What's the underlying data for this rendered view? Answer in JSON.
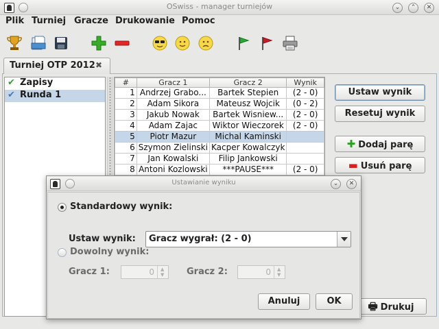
{
  "window": {
    "title": "OSwiss - manager turniejów",
    "minimize": "⌄",
    "maximize": "⌃",
    "close": "✕"
  },
  "menu": [
    "Plik",
    "Turniej",
    "Gracze",
    "Drukowanie",
    "Pomoc"
  ],
  "toolbar": {
    "icons": [
      "trophy-icon",
      "open-icon",
      "save-icon",
      "add-icon",
      "remove-icon",
      "cool-face-icon",
      "smile-face-icon",
      "sad-face-icon",
      "green-flag-icon",
      "red-flag-icon",
      "printer-icon"
    ]
  },
  "tab": {
    "label": "Turniej OTP 2012",
    "close": "✖"
  },
  "rounds": [
    {
      "label": "Zapisy",
      "check": "✔",
      "check_color": "#3a9a3a",
      "selected": false
    },
    {
      "label": "Runda 1",
      "check": "✔",
      "check_color": "#4a78b8",
      "selected": true
    }
  ],
  "table": {
    "headers": [
      "#",
      "Gracz 1",
      "Gracz 2",
      "Wynik"
    ],
    "rows": [
      [
        "1",
        "Andrzej Grabo...",
        "Bartek Stepien",
        "(2 - 0)"
      ],
      [
        "2",
        "Adam Sikora",
        "Mateusz Wojcik",
        "(0 - 2)"
      ],
      [
        "3",
        "Jakub Nowak",
        "Bartek Wisniew...",
        "(2 - 0)"
      ],
      [
        "4",
        "Adam Zajac",
        "Wiktor Wieczorek",
        "(2 - 0)"
      ],
      [
        "5",
        "Piotr Mazur",
        "Michal Kaminski",
        ""
      ],
      [
        "6",
        "Szymon Zielinski",
        "Kacper Kowalczyk",
        ""
      ],
      [
        "7",
        "Jan Kowalski",
        "Filip Jankowski",
        ""
      ],
      [
        "8",
        "Antoni Kozlowski",
        "***PAUSE***",
        "(2 - 0)"
      ]
    ],
    "selected_row": 4
  },
  "buttons": {
    "set_result": "Ustaw wynik",
    "reset_result": "Resetuj wynik",
    "add_pair": "Dodaj parę",
    "remove_pair": "Usuń parę",
    "print": "Drukuj"
  },
  "dialog": {
    "title": "Ustawianie wyniku",
    "standard_label": "Standardowy wynik:",
    "set_result_label": "Ustaw wynik:",
    "combo_value": "Gracz wygrał: (2 - 0)",
    "custom_label": "Dowolny wynik:",
    "player1_label": "Gracz 1:",
    "player2_label": "Gracz 2:",
    "player1_value": "0",
    "player2_value": "0",
    "cancel": "Anuluj",
    "ok": "OK"
  }
}
